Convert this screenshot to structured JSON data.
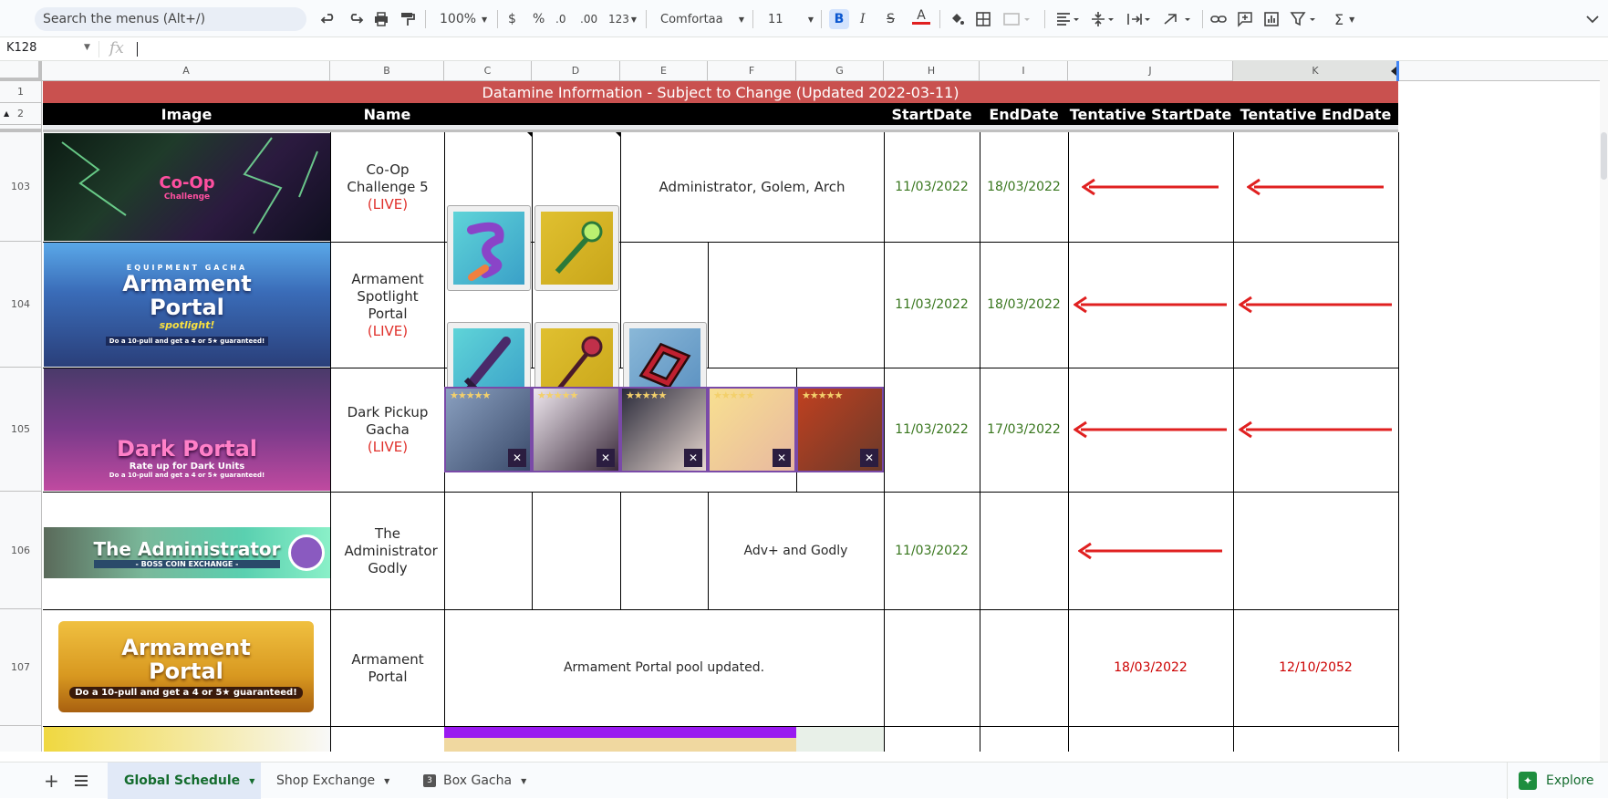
{
  "toolbar": {
    "search_placeholder": "Search the menus (Alt+/)",
    "zoom": "100%",
    "currency": "$",
    "percent": "%",
    "dec_decrease": ".0",
    "dec_increase": ".00",
    "number_format": "123",
    "font": "Comfortaa",
    "font_size": "11",
    "bold": "B",
    "italic": "I",
    "strike": "S",
    "text_color": "A"
  },
  "formula_bar": {
    "cell_ref": "K128",
    "fx": "fx"
  },
  "columns": [
    "A",
    "B",
    "C",
    "D",
    "E",
    "F",
    "G",
    "H",
    "I",
    "J",
    "K"
  ],
  "rows": {
    "title": "Datamine Information - Subject to Change (Updated 2022-03-11)",
    "headers": {
      "image": "Image",
      "name": "Name",
      "start": "StartDate",
      "end": "EndDate",
      "tstart": "Tentative StartDate",
      "tend": "Tentative EndDate"
    },
    "row_numbers": [
      "1",
      "2",
      "103",
      "104",
      "105",
      "106",
      "107"
    ],
    "r103": {
      "name": "Co-Op Challenge 5",
      "live": "(LIVE)",
      "units": "Administrator, Golem, Arch",
      "start": "11/03/2022",
      "end": "18/03/2022",
      "banner_title": "Co-Op",
      "banner_sub": "Challenge"
    },
    "r104": {
      "name": "Armament Spotlight Portal",
      "live": "(LIVE)",
      "start": "11/03/2022",
      "end": "18/03/2022",
      "banner_top": "EQUIPMENT GACHA",
      "banner_title": "Armament Portal",
      "banner_sub": "spotlight!",
      "banner_foot": "Do a 10-pull and get a 4 or 5★ guaranteed!"
    },
    "r105": {
      "name": "Dark Pickup Gacha",
      "live": "(LIVE)",
      "start": "11/03/2022",
      "end": "17/03/2022",
      "banner_title": "Dark Portal",
      "banner_sub": "Rate up for Dark Units",
      "banner_foot": "Do a 10-pull and get a 4 or 5★ guaranteed!"
    },
    "r106": {
      "name": "The Administrator Godly",
      "note": "Adv+ and Godly",
      "start": "11/03/2022",
      "banner_title": "The Administrator",
      "banner_sub": "- BOSS COIN EXCHANGE -"
    },
    "r107": {
      "name": "Armament Portal",
      "note": "Armament Portal pool updated.",
      "tstart": "18/03/2022",
      "tend": "12/10/2052",
      "banner_title": "Armament Portal",
      "banner_foot": "Do a 10-pull and get a 4 or 5★ guaranteed!"
    }
  },
  "sheet_tabs": {
    "active": "Global Schedule",
    "tab2": "Shop Exchange",
    "tab3": "Box Gacha",
    "tab3_badge": "3",
    "explore": "Explore"
  },
  "colors": {
    "title_bg": "#c9514f",
    "header_bg": "#000000",
    "date_green": "#38761d",
    "date_red": "#cc0000",
    "arrow": "#e02020"
  }
}
